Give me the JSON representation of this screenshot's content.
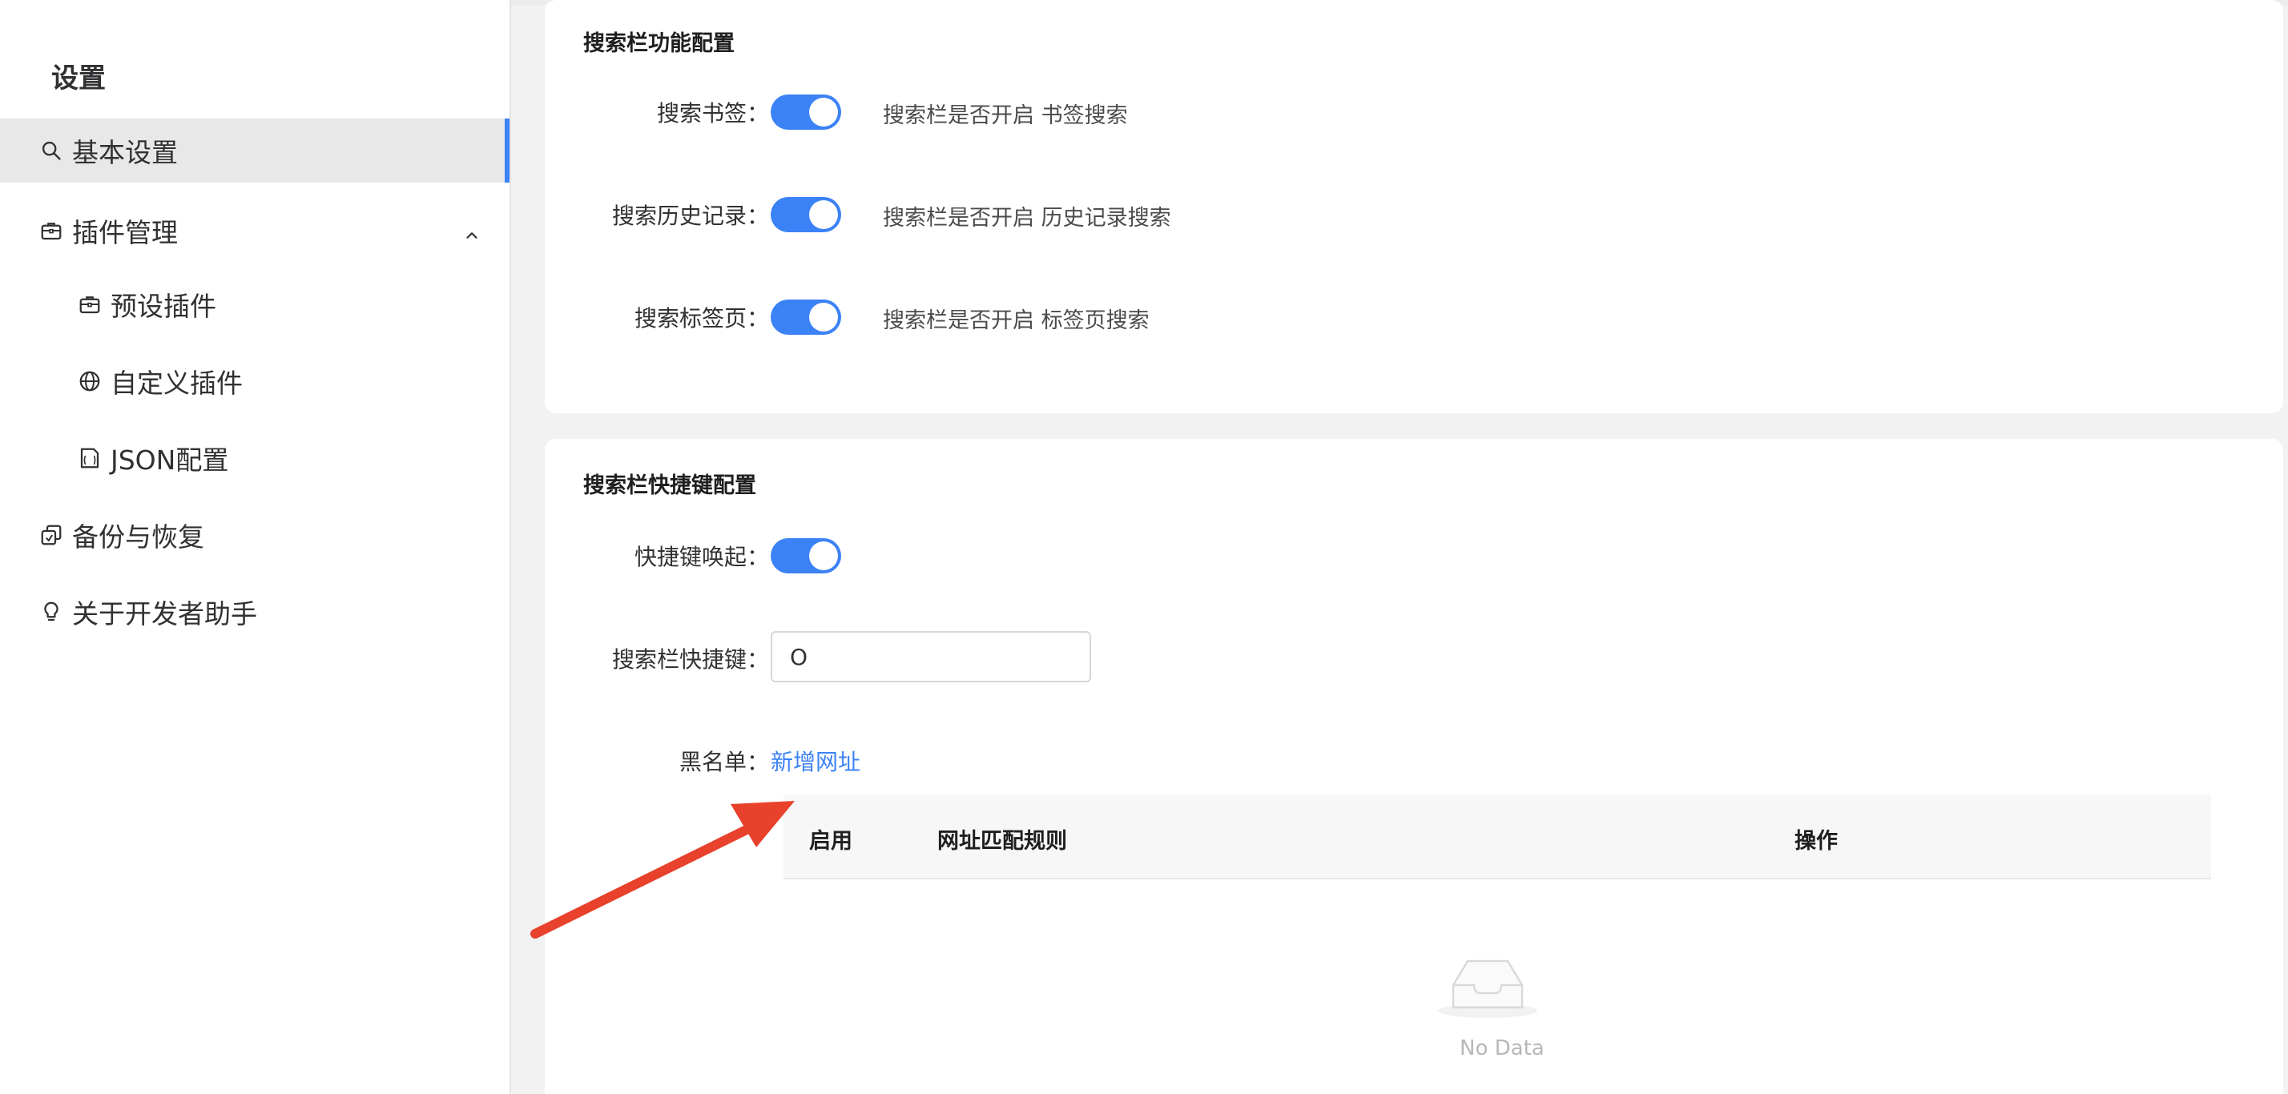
{
  "sidebar": {
    "title": "设置",
    "items": [
      {
        "label": "基本设置",
        "icon": "search-icon",
        "active": true
      },
      {
        "label": "插件管理",
        "icon": "briefcase-icon",
        "expanded": true
      },
      {
        "label": "预设插件",
        "icon": "briefcase-icon"
      },
      {
        "label": "自定义插件",
        "icon": "globe-icon"
      },
      {
        "label": "JSON配置",
        "icon": "json-file-icon"
      },
      {
        "label": "备份与恢复",
        "icon": "copy-icon"
      },
      {
        "label": "关于开发者助手",
        "icon": "bulb-icon"
      }
    ]
  },
  "search_features": {
    "title": "搜索栏功能配置",
    "rows": [
      {
        "label": "搜索书签：",
        "enabled": true,
        "desc": "搜索栏是否开启 书签搜索"
      },
      {
        "label": "搜索历史记录：",
        "enabled": true,
        "desc": "搜索栏是否开启 历史记录搜索"
      },
      {
        "label": "搜索标签页：",
        "enabled": true,
        "desc": "搜索栏是否开启 标签页搜索"
      }
    ]
  },
  "shortcut_config": {
    "title": "搜索栏快捷键配置",
    "wake_label": "快捷键唤起：",
    "wake_enabled": true,
    "hotkey_label": "搜索栏快捷键：",
    "hotkey_value": "O",
    "blacklist_label": "黑名单：",
    "add_url_link": "新增网址",
    "table": {
      "columns": [
        "启用",
        "网址匹配规则",
        "操作"
      ],
      "empty_text": "No Data"
    }
  },
  "colors": {
    "accent": "#3b82f6",
    "annotation_arrow": "#e8412c"
  }
}
